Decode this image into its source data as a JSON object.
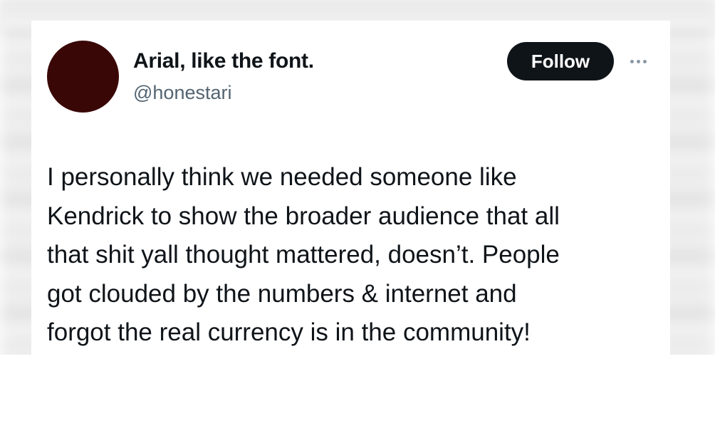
{
  "author": {
    "display_name": "Arial, like the font.",
    "handle": "@honestari",
    "avatar_color": "#3a0707"
  },
  "actions": {
    "follow_label": "Follow",
    "more_icon": "more-horizontal-icon"
  },
  "tweet": {
    "lines": [
      "I personally think we needed someone like",
      "Kendrick to show the broader audience that all",
      "that shit yall thought mattered, doesn’t. People",
      "got clouded by the numbers & internet and",
      "forgot the real currency is in the community!"
    ]
  },
  "colors": {
    "text_primary": "#0f1419",
    "text_secondary": "#536471",
    "button_bg": "#0f1419",
    "button_text": "#ffffff"
  }
}
